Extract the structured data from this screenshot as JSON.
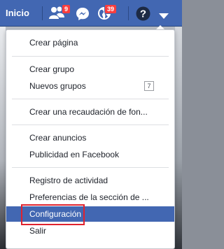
{
  "topbar": {
    "home_label": "Inicio",
    "friend_requests_count": "9",
    "notifications_count": "39",
    "icons": {
      "friend_requests": "friends-icon",
      "messenger": "messenger-icon",
      "notifications": "globe-icon",
      "help": "help-icon",
      "account_menu": "caret-down-icon"
    }
  },
  "menu": {
    "items": [
      {
        "label": "Crear página"
      },
      {
        "label": "Crear grupo"
      },
      {
        "label": "Nuevos grupos",
        "count": "7"
      },
      {
        "label": "Crear una recaudación de fon..."
      },
      {
        "label": "Crear anuncios"
      },
      {
        "label": "Publicidad en Facebook"
      },
      {
        "label": "Registro de actividad"
      },
      {
        "label": "Preferencias de la sección de ..."
      },
      {
        "label": "Configuración",
        "selected": true
      },
      {
        "label": "Salir"
      }
    ]
  },
  "colors": {
    "brand": "#4267b2",
    "badge": "#fa3e3e",
    "highlight_box": "#e0232e"
  }
}
